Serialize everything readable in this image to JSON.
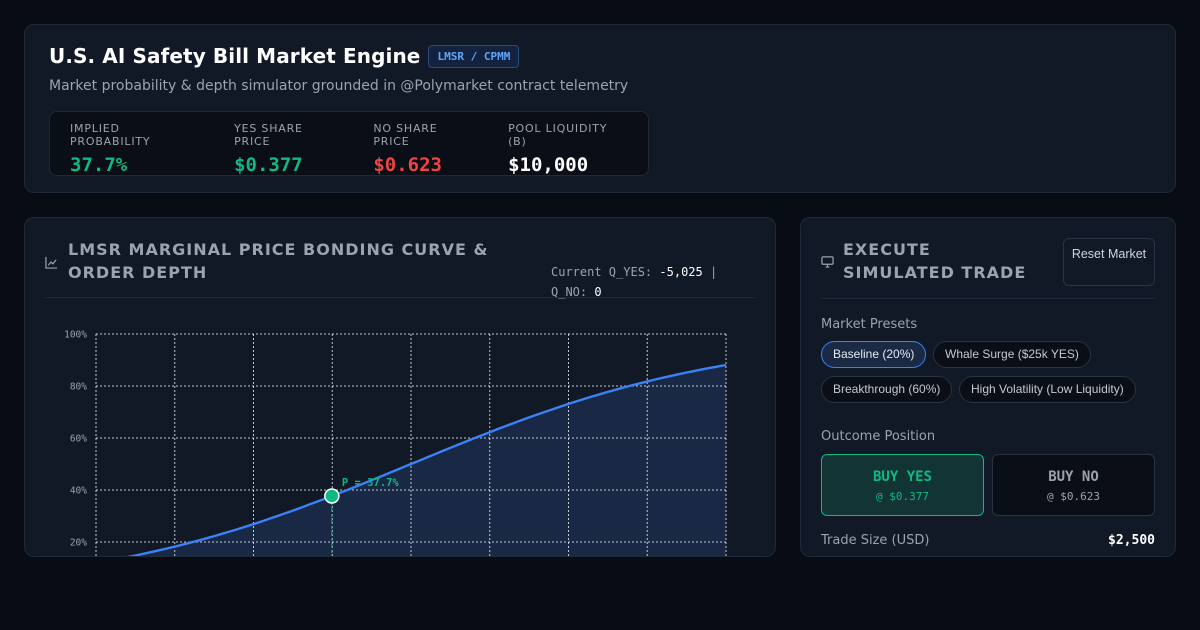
{
  "header": {
    "title": "U.S. AI Safety Bill Market Engine",
    "badge": "LMSR / CPMM",
    "subtitle": "Market probability & depth simulator grounded in @Polymarket contract telemetry",
    "stats": [
      {
        "label": "IMPLIED PROBABILITY",
        "value": "37.7%",
        "color": "#10b981"
      },
      {
        "label": "YES SHARE PRICE",
        "value": "$0.377",
        "color": "#10b981"
      },
      {
        "label": "NO SHARE PRICE",
        "value": "$0.623",
        "color": "#ef4444"
      },
      {
        "label": "POOL LIQUIDITY (B)",
        "value": "$10,000",
        "color": "#ffffff"
      }
    ]
  },
  "chart_panel": {
    "title": "LMSR MARGINAL PRICE BONDING CURVE & ORDER DEPTH",
    "q_yes_label": "Current Q_YES:",
    "q_yes_value": "-5,025",
    "separator": "|",
    "q_no_label": "Q_NO:",
    "q_no_value": "0"
  },
  "chart_data": {
    "type": "area",
    "y_tick_labels": [
      "100%",
      "80%",
      "60%",
      "40%",
      "20%"
    ],
    "y_ticks": [
      1.0,
      0.8,
      0.6,
      0.4,
      0.2
    ],
    "ylim": [
      0,
      1
    ],
    "x_range": [
      -20000,
      20000
    ],
    "liquidity_b": 10000,
    "current_q": -5025,
    "current_p": 0.377,
    "marker_label": "P = 37.7%",
    "line_color": "#3b82f6",
    "marker_color": "#10b981",
    "grid": true
  },
  "trade_panel": {
    "title": "EXECUTE SIMULATED TRADE",
    "reset_label": "Reset Market",
    "presets_label": "Market Presets",
    "presets": [
      {
        "label": "Baseline (20%)",
        "active": true
      },
      {
        "label": "Whale Surge ($25k YES)",
        "active": false
      },
      {
        "label": "Breakthrough (60%)",
        "active": false
      },
      {
        "label": "High Volatility (Low Liquidity)",
        "active": false
      }
    ],
    "outcome_label": "Outcome Position",
    "buy_yes": {
      "label": "BUY YES",
      "price": "@ $0.377"
    },
    "buy_no": {
      "label": "BUY NO",
      "price": "@ $0.623"
    },
    "trade_size_label": "Trade Size (USD)",
    "trade_size_value": "$2,500"
  }
}
